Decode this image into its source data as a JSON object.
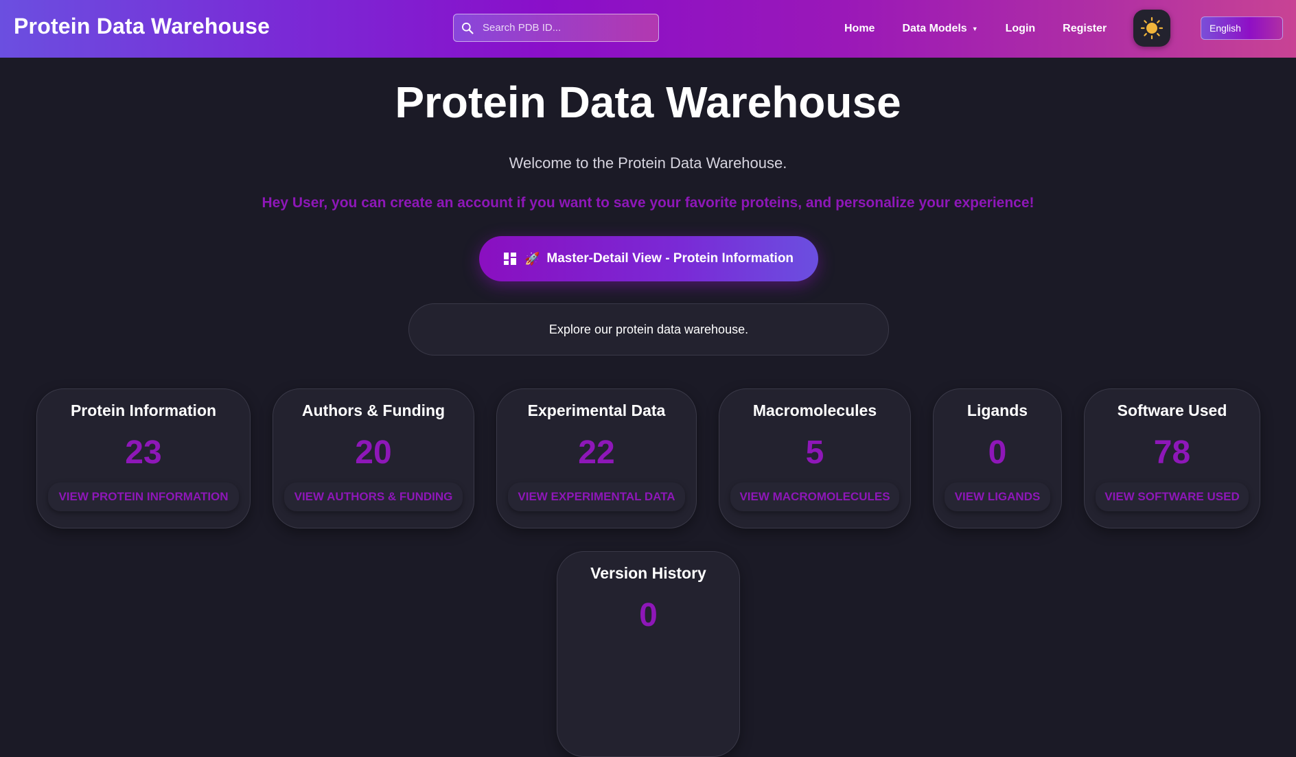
{
  "navbar": {
    "brand": "Protein Data Warehouse",
    "search_placeholder": "Search PDB ID...",
    "links": {
      "home": "Home",
      "data_models": "Data Models",
      "login": "Login",
      "register": "Register"
    },
    "language": "English",
    "theme_icon": "sun-icon"
  },
  "main": {
    "title": "Protein Data Warehouse",
    "welcome": "Welcome to the Protein Data Warehouse.",
    "prompt": "Hey User, you can create an account if you want to save your favorite proteins, and personalize your experience!",
    "master_detail_button": "Master-Detail View - Protein Information",
    "master_detail_icons": [
      "dashboard-icon",
      "rocket-icon"
    ],
    "explore_text": "Explore our protein data warehouse."
  },
  "cards": [
    {
      "title": "Protein Information",
      "count": "23",
      "link": "View Protein Information"
    },
    {
      "title": "Authors & Funding",
      "count": "20",
      "link": "View Authors & Funding"
    },
    {
      "title": "Experimental Data",
      "count": "22",
      "link": "View Experimental Data"
    },
    {
      "title": "Macromolecules",
      "count": "5",
      "link": "View Macromolecules"
    },
    {
      "title": "Ligands",
      "count": "0",
      "link": "View Ligands"
    },
    {
      "title": "Software Used",
      "count": "78",
      "link": "View Software Used"
    },
    {
      "title": "Version History",
      "count": "0",
      "link": ""
    }
  ],
  "colors": {
    "accent": "#8e17b8",
    "background": "#1b1a26",
    "card": "#23222f",
    "sun": "#f2b53c"
  }
}
